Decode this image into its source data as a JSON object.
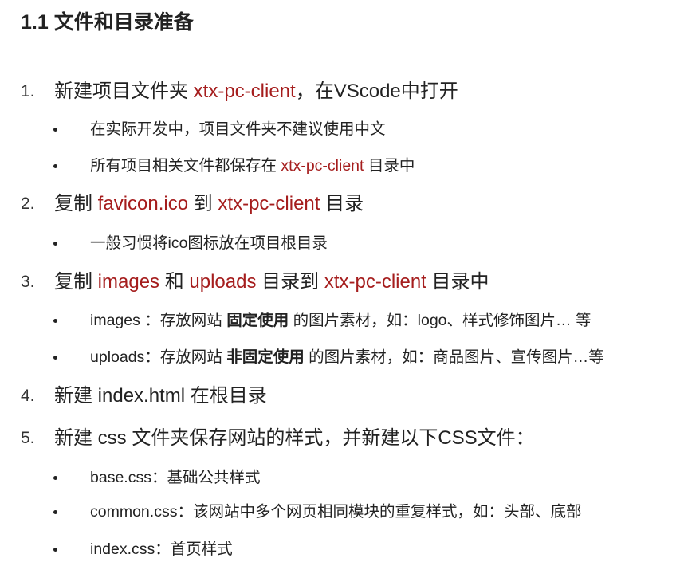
{
  "heading": "1.1 文件和目录准备",
  "accent_color": "#a51d1d",
  "steps": [
    {
      "number": "1.",
      "parts": [
        "新建项目文件夹 ",
        "xtx-pc-client",
        "，在VScode中打开"
      ],
      "bullets": [
        {
          "parts": [
            "在实际开发中，项目文件夹不建议使用中文"
          ]
        },
        {
          "parts": [
            "所有项目相关文件都保存在 ",
            "xtx-pc-client",
            " 目录中"
          ]
        }
      ]
    },
    {
      "number": "2.",
      "parts": [
        "复制 ",
        "favicon.ico",
        " 到 ",
        "xtx-pc-client",
        " 目录"
      ],
      "bullets": [
        {
          "parts": [
            "一般习惯将ico图标放在项目根目录"
          ]
        }
      ]
    },
    {
      "number": "3.",
      "parts": [
        "复制 ",
        "images",
        " 和 ",
        "uploads",
        " 目录到 ",
        "xtx-pc-client",
        " 目录中"
      ],
      "bullets": [
        {
          "parts": [
            "images ：存放网站 ",
            "固定使用",
            " 的图片素材，如：logo、样式修饰图片… 等"
          ]
        },
        {
          "parts": [
            "uploads：存放网站 ",
            "非固定使用",
            " 的图片素材，如：商品图片、宣传图片…等"
          ]
        }
      ]
    },
    {
      "number": "4.",
      "parts": [
        "新建 index.html 在根目录"
      ],
      "bullets": []
    },
    {
      "number": "5.",
      "parts": [
        "新建 css 文件夹保存网站的样式，并新建以下CSS文件："
      ],
      "bullets": [
        {
          "parts": [
            "base.css：基础公共样式"
          ]
        },
        {
          "parts": [
            "common.css：该网站中多个网页相同模块的重复样式，如：头部、底部"
          ]
        },
        {
          "parts": [
            "index.css：首页样式"
          ]
        }
      ]
    }
  ]
}
